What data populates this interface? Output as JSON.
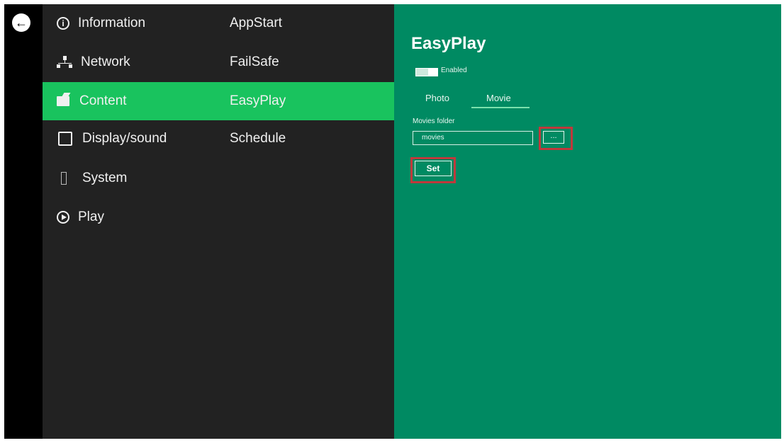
{
  "nav": {
    "back_icon": "arrow-left-circle-icon",
    "categories": [
      {
        "label": "Information",
        "icon": "info-circle-icon"
      },
      {
        "label": "Network",
        "icon": "network-icon"
      },
      {
        "label": "Content",
        "icon": "folder-icon"
      },
      {
        "label": "Display/sound",
        "icon": "display-icon"
      },
      {
        "label": "System",
        "icon": "phone-icon"
      },
      {
        "label": "Play",
        "icon": "play-circle-icon"
      }
    ],
    "sub_items": [
      "AppStart",
      "FailSafe",
      "EasyPlay",
      "Schedule"
    ],
    "active_category": "Content",
    "active_sub_item": "EasyPlay"
  },
  "panel": {
    "title": "EasyPlay",
    "toggle_label": "Enabled",
    "toggle_on": true,
    "tabs": [
      {
        "label": "Photo",
        "active": false
      },
      {
        "label": "Movie",
        "active": true
      }
    ],
    "folder_label": "Movies folder",
    "folder_value": "movies",
    "browse_label": "...",
    "set_label": "Set"
  },
  "colors": {
    "accent": "#19c35e",
    "panel_bg": "#008a62",
    "menu_bg": "#222222",
    "highlight": "#c0393b"
  }
}
